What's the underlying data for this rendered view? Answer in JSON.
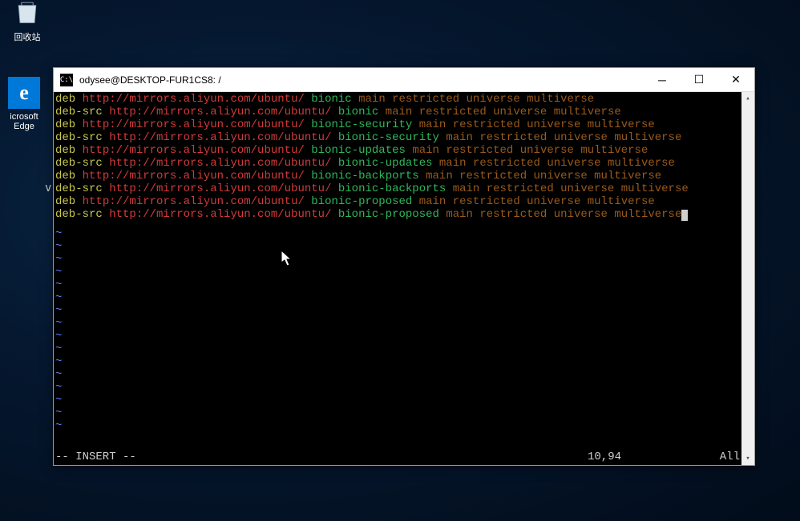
{
  "desktop": {
    "recycle_label": "回收站",
    "edge_label": "icrosoft\nEdge",
    "left_letter": "v"
  },
  "window": {
    "title": "odysee@DESKTOP-FUR1CS8: /",
    "icon_text": "C:\\"
  },
  "vim": {
    "mode": "-- INSERT --",
    "position": "10,94",
    "percent": "All",
    "tilde": "~"
  },
  "lines": [
    {
      "type": "deb",
      "dist": "bionic",
      "comp": "main restricted universe multiverse"
    },
    {
      "type": "deb-src",
      "dist": "bionic",
      "comp": "main restricted universe multiverse"
    },
    {
      "type": "deb",
      "dist": "bionic-security",
      "comp": "main restricted universe multiverse"
    },
    {
      "type": "deb-src",
      "dist": "bionic-security",
      "comp": "main restricted universe multiverse"
    },
    {
      "type": "deb",
      "dist": "bionic-updates",
      "comp": "main restricted universe multiverse"
    },
    {
      "type": "deb-src",
      "dist": "bionic-updates",
      "comp": "main restricted universe multiverse"
    },
    {
      "type": "deb",
      "dist": "bionic-backports",
      "comp": "main restricted universe multiverse"
    },
    {
      "type": "deb-src",
      "dist": "bionic-backports",
      "comp": "main restricted universe multiverse"
    },
    {
      "type": "deb",
      "dist": "bionic-proposed",
      "comp": "main restricted universe multiverse"
    },
    {
      "type": "deb-src",
      "dist": "bionic-proposed",
      "comp": "main restricted universe multiverse"
    }
  ],
  "url": "http://mirrors.aliyun.com/ubuntu/",
  "tilde_count": 16
}
